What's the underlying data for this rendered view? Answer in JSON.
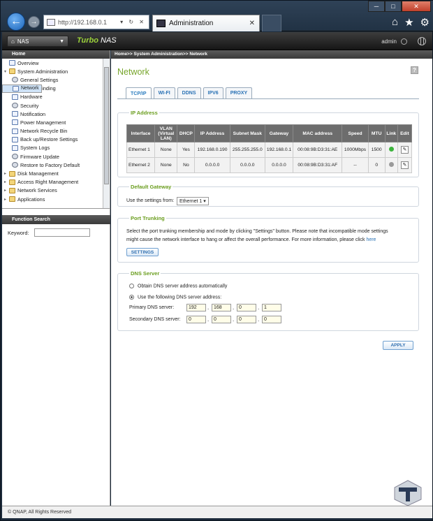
{
  "browser": {
    "address": "http://192.168.0.1",
    "tab_title": "Administration",
    "address_controls": "▾ ↻ ✕",
    "win_min": "─",
    "win_max": "□",
    "win_close": "✕",
    "tool_icons": [
      "home-icon",
      "star-icon",
      "gear-icon"
    ]
  },
  "header": {
    "nas_button": "NAS",
    "brand_prefix": "Turbo",
    "brand_suffix": "NAS",
    "user": "admin"
  },
  "sidebar": {
    "home_label": "Home",
    "items": [
      {
        "label": "Overview",
        "level": 0,
        "icon": "page"
      },
      {
        "label": "System Administration",
        "level": 0,
        "icon": "folder",
        "expanded": true
      },
      {
        "label": "General Settings",
        "level": 1,
        "icon": "gear"
      },
      {
        "label": "Network",
        "level": 1,
        "icon": "page",
        "selected": true
      },
      {
        "label": "Service Binding",
        "level": 1,
        "icon": "gear"
      },
      {
        "label": "Hardware",
        "level": 1,
        "icon": "page"
      },
      {
        "label": "Security",
        "level": 1,
        "icon": "gear"
      },
      {
        "label": "Notification",
        "level": 1,
        "icon": "page"
      },
      {
        "label": "Power Management",
        "level": 1,
        "icon": "page"
      },
      {
        "label": "Network Recycle Bin",
        "level": 1,
        "icon": "page"
      },
      {
        "label": "Back up/Restore Settings",
        "level": 1,
        "icon": "page"
      },
      {
        "label": "System Logs",
        "level": 1,
        "icon": "page"
      },
      {
        "label": "Firmware Update",
        "level": 1,
        "icon": "gear"
      },
      {
        "label": "Restore to Factory Default",
        "level": 1,
        "icon": "gear"
      },
      {
        "label": "Disk Management",
        "level": 0,
        "icon": "folder"
      },
      {
        "label": "Access Right Management",
        "level": 0,
        "icon": "folder"
      },
      {
        "label": "Network Services",
        "level": 0,
        "icon": "folder"
      },
      {
        "label": "Applications",
        "level": 0,
        "icon": "folder"
      }
    ],
    "function_search": "Function Search",
    "keyword_label": "Keyword:"
  },
  "main": {
    "breadcrumb": "Home>> System Administration>> Network",
    "title": "Network",
    "help": "?",
    "tabs": [
      "TCP/IP",
      "WI-FI",
      "DDNS",
      "IPV6",
      "PROXY"
    ],
    "ip_section": {
      "legend": "IP Address",
      "columns": [
        "Interface",
        "VLAN (Virtual LAN)",
        "DHCP",
        "IP Address",
        "Subnet Mask",
        "Gateway",
        "MAC address",
        "Speed",
        "MTU",
        "Link",
        "Edit"
      ],
      "rows": [
        {
          "interface": "Ethernet 1",
          "vlan": "None",
          "dhcp": "Yes",
          "ip": "192.168.0.190",
          "mask": "255.255.255.0",
          "gateway": "192.168.0.1",
          "mac": "00:08:9B:D3:31:AE",
          "speed": "1000Mbps",
          "mtu": "1500",
          "link_color": "#3cb43c"
        },
        {
          "interface": "Ethernet 2",
          "vlan": "None",
          "dhcp": "No",
          "ip": "0.0.0.0",
          "mask": "0.0.0.0",
          "gateway": "0.0.0.0",
          "mac": "00:08:9B:D3:31:AF",
          "speed": "--",
          "mtu": "0",
          "link_color": "#9a9a9a"
        }
      ]
    },
    "gateway_section": {
      "legend": "Default Gateway",
      "label": "Use the settings from:",
      "value": "Ethernet 1"
    },
    "trunk_section": {
      "legend": "Port Trunking",
      "text1": "Select the port trunking membership and mode by clicking \"Settings\" button. Please note that incompatible mode settings",
      "text2": "might cause the network interface to hang or affect the overall performance. For more information, please click",
      "link": "here",
      "button": "SETTINGS"
    },
    "dns_section": {
      "legend": "DNS Server",
      "opt_auto": "Obtain DNS server address automatically",
      "opt_manual": "Use the following DNS server address:",
      "primary_label": "Primary DNS server:",
      "primary": [
        "192",
        "168",
        "0",
        "1"
      ],
      "secondary_label": "Secondary DNS server:",
      "secondary": [
        "0",
        "0",
        "0",
        "0"
      ]
    },
    "apply": "APPLY"
  },
  "status": "© QNAP, All Rights Reserved"
}
